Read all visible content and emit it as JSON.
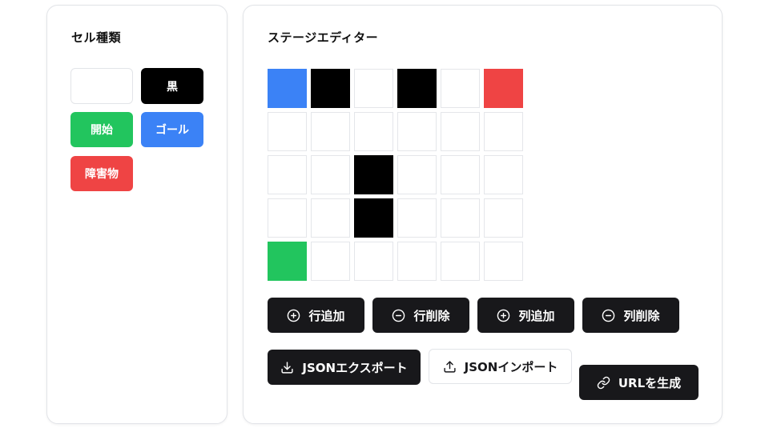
{
  "palette": {
    "title": "セル種類",
    "items": [
      {
        "key": "empty",
        "label": "",
        "color": "#ffffff"
      },
      {
        "key": "black",
        "label": "黒",
        "color": "#000000"
      },
      {
        "key": "start",
        "label": "開始",
        "color": "#22c55e"
      },
      {
        "key": "goal",
        "label": "ゴール",
        "color": "#3b82f6"
      },
      {
        "key": "obstacle",
        "label": "障害物",
        "color": "#ef4444"
      }
    ]
  },
  "editor": {
    "title": "ステージエディター",
    "grid": {
      "rows": 5,
      "cols": 6,
      "cells": [
        [
          "goal",
          "black",
          "empty",
          "black",
          "empty",
          "obstacle"
        ],
        [
          "empty",
          "empty",
          "empty",
          "empty",
          "empty",
          "empty"
        ],
        [
          "empty",
          "empty",
          "black",
          "empty",
          "empty",
          "empty"
        ],
        [
          "empty",
          "empty",
          "black",
          "empty",
          "empty",
          "empty"
        ],
        [
          "start",
          "empty",
          "empty",
          "empty",
          "empty",
          "empty"
        ]
      ]
    },
    "actions": {
      "add_row": {
        "label": "行追加",
        "icon": "plus-circle-icon"
      },
      "delete_row": {
        "label": "行削除",
        "icon": "minus-circle-icon"
      },
      "add_col": {
        "label": "列追加",
        "icon": "plus-circle-icon"
      },
      "delete_col": {
        "label": "列削除",
        "icon": "minus-circle-icon"
      },
      "export_json": {
        "label": "JSONエクスポート",
        "icon": "download-icon"
      },
      "import_json": {
        "label": "JSONインポート",
        "icon": "upload-icon"
      },
      "generate_url": {
        "label": "URLを生成",
        "icon": "link-icon"
      }
    }
  },
  "colors": {
    "empty": "#ffffff",
    "black": "#000000",
    "start": "#22c55e",
    "goal": "#3b82f6",
    "obstacle": "#ef4444",
    "button_dark": "#18181b",
    "border": "#e2e4e8"
  }
}
